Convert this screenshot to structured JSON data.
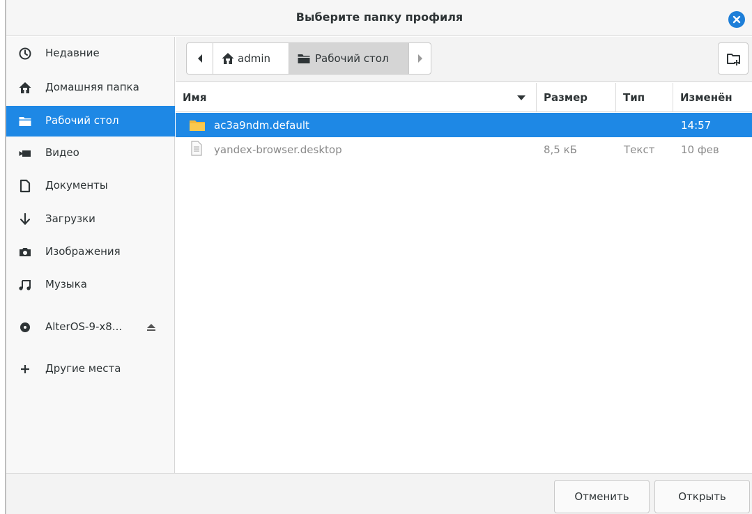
{
  "window": {
    "title": "Выберите папку профиля"
  },
  "sidebar": {
    "items": [
      {
        "label": "Недавние",
        "icon": "clock-icon"
      },
      {
        "label": "Домашняя папка",
        "icon": "home-icon"
      },
      {
        "label": "Рабочий стол",
        "icon": "folder-icon",
        "active": true
      },
      {
        "label": "Видео",
        "icon": "video-icon"
      },
      {
        "label": "Документы",
        "icon": "document-icon"
      },
      {
        "label": "Загрузки",
        "icon": "download-icon"
      },
      {
        "label": "Изображения",
        "icon": "camera-icon"
      },
      {
        "label": "Музыка",
        "icon": "music-icon"
      },
      {
        "label": "AlterOS-9-x8...",
        "icon": "disc-icon",
        "eject": "eject-icon"
      },
      {
        "label": "Другие места",
        "icon": "plus-icon"
      }
    ]
  },
  "pathbar": {
    "back_icon": "chevron-left-icon",
    "segments": [
      {
        "label": "admin",
        "icon": "home-icon"
      },
      {
        "label": "Рабочий стол",
        "icon": "folder-icon",
        "active": true
      }
    ],
    "forward_icon": "chevron-right-icon",
    "new_folder_icon": "new-folder-icon"
  },
  "filelist": {
    "columns": {
      "name": "Имя",
      "size": "Размер",
      "type": "Тип",
      "modified": "Изменён"
    },
    "rows": [
      {
        "name": "ac3a9ndm.default",
        "size": "",
        "type": "",
        "modified": "14:57",
        "icon": "folder-icon",
        "selected": true
      },
      {
        "name": "yandex-browser.desktop",
        "size": "8,5 кБ",
        "type": "Текст",
        "modified": "10 фев",
        "icon": "text-file-icon",
        "selected": false
      }
    ]
  },
  "buttons": {
    "cancel": "Отменить",
    "open": "Открыть"
  },
  "colors": {
    "accent": "#1e88e5",
    "folder": "#f5b83a"
  }
}
